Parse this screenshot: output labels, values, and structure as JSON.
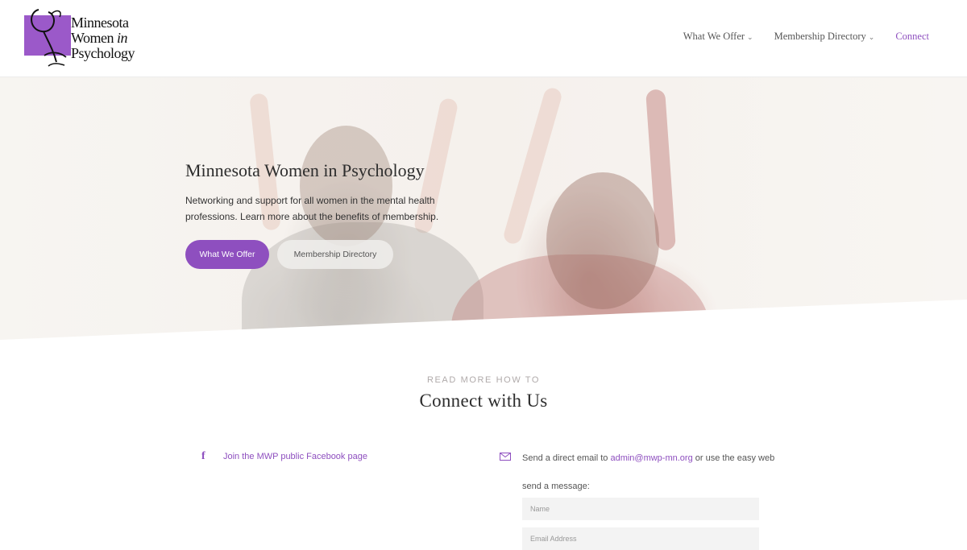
{
  "header": {
    "logo": {
      "line1": "Minnesota",
      "line2a": "Women ",
      "line2b": "in",
      "line3": "Psychology"
    },
    "nav": [
      {
        "label": "What We Offer",
        "has_dropdown": true
      },
      {
        "label": "Membership Directory",
        "has_dropdown": true
      },
      {
        "label": "Connect",
        "has_dropdown": false,
        "active": true
      }
    ]
  },
  "hero": {
    "title": "Minnesota Women in Psychology",
    "text": "Networking and support for all women in the mental health professions. Learn more about the benefits of membership.",
    "primary_button": "What We Offer",
    "secondary_button": "Membership Directory"
  },
  "connect": {
    "eyebrow": "READ MORE HOW TO",
    "title": "Connect with Us",
    "facebook": {
      "icon": "facebook-icon",
      "link_text": "Join the MWP public Facebook page"
    },
    "email": {
      "icon": "envelope-icon",
      "intro_before": "Send a direct email to ",
      "address": "admin@mwp-mn.org",
      "intro_after": " or use the easy web",
      "send_label": "send a message:"
    },
    "form": {
      "name_placeholder": "Name",
      "email_placeholder": "Email Address"
    }
  },
  "colors": {
    "accent": "#8e4fbf",
    "logo_box": "#9b59c9"
  }
}
